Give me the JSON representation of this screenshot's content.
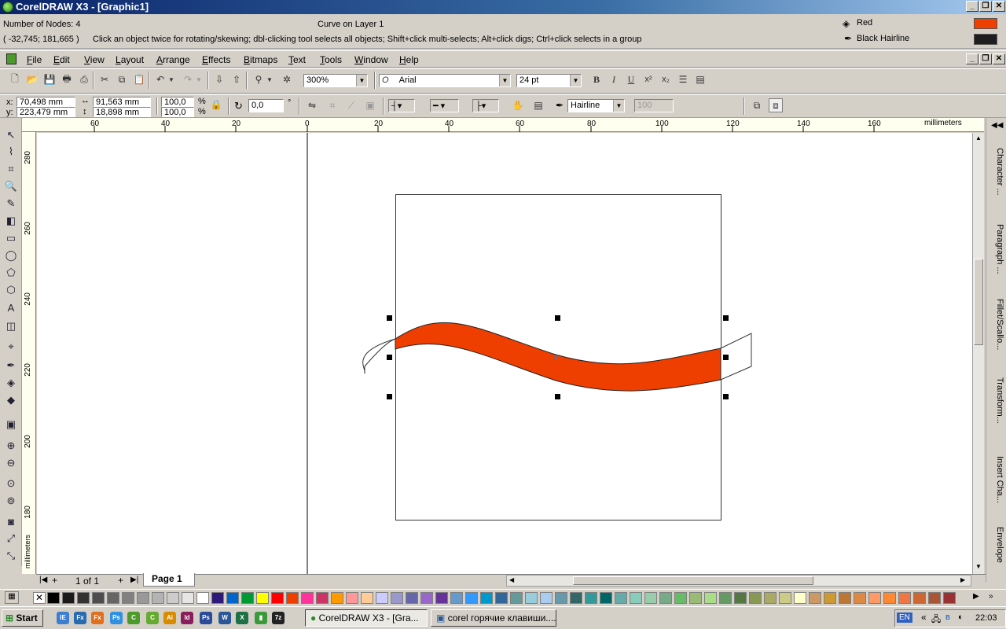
{
  "window": {
    "title": "CorelDRAW X3 - [Graphic1]"
  },
  "info": {
    "nodes": "Number of Nodes: 4",
    "object": "Curve on Layer 1",
    "coords": "( -32,745; 181,665 )",
    "hint": "Click an object twice for rotating/skewing; dbl-clicking tool selects all objects; Shift+click multi-selects; Alt+click digs; Ctrl+click selects in a group",
    "fill_label": "Red",
    "outline_label": "Black  Hairline",
    "fill_color": "#ee3e00",
    "outline_color": "#1e1e1e"
  },
  "menu": [
    "File",
    "Edit",
    "View",
    "Layout",
    "Arrange",
    "Effects",
    "Bitmaps",
    "Text",
    "Tools",
    "Window",
    "Help"
  ],
  "toolbar": {
    "zoom": "300%",
    "font": "Arial",
    "font_size": "24 pt"
  },
  "properties": {
    "x": "70,498 mm",
    "y": "223,479 mm",
    "width": "91,563 mm",
    "height": "18,898 mm",
    "scale_x": "100,0",
    "scale_y": "100,0",
    "pct1": "%",
    "pct2": "%",
    "angle": "0,0",
    "deg": "°",
    "outline_width": "Hairline",
    "opacity": "100"
  },
  "ruler": {
    "h_ticks": [
      "60",
      "40",
      "20",
      "0",
      "20",
      "40",
      "60",
      "80",
      "100",
      "120",
      "140",
      "160"
    ],
    "v_ticks": [
      "280",
      "260",
      "240",
      "220",
      "200",
      "180"
    ],
    "units": "millimeters",
    "v_units": "millimeters"
  },
  "dockers": [
    "Character ...",
    "Paragraph ...",
    "Fillet/Scallo...",
    "Transform...",
    "Insert Cha...",
    "Envelope"
  ],
  "pagebar": {
    "count": "1 of 1",
    "page_tab": "Page 1"
  },
  "palette_colors": [
    "#000000",
    "#1a1a1a",
    "#333333",
    "#4d4d4d",
    "#666666",
    "#808080",
    "#999999",
    "#b3b3b3",
    "#cccccc",
    "#e6e6e6",
    "#ffffff",
    "#2e1a78",
    "#0066cc",
    "#009933",
    "#ffff00",
    "#ff0000",
    "#ee3e00",
    "#ff3399",
    "#cc3366",
    "#ff9900",
    "#ff9999",
    "#ffcc99",
    "#ccccff",
    "#9999cc",
    "#6666aa",
    "#9966cc",
    "#663399",
    "#6699cc",
    "#3399ff",
    "#0099cc",
    "#336699",
    "#669999",
    "#99ccdd",
    "#aaccee",
    "#6699aa",
    "#336666",
    "#339999",
    "#006666",
    "#66aaaa",
    "#88ccbb",
    "#99ccaa",
    "#77aa88",
    "#66bb66",
    "#99bb77",
    "#aadd88",
    "#669966",
    "#557744",
    "#889955",
    "#aaaa66",
    "#cccc88",
    "#ffffcc",
    "#cc9966",
    "#cc9933",
    "#bb7733",
    "#dd8844",
    "#ff9966",
    "#ff8833",
    "#ee7744",
    "#cc6633",
    "#aa5533",
    "#993333"
  ],
  "taskbar": {
    "start": "Start",
    "task1": "CorelDRAW X3 - [Gra...",
    "task2": "corel горячие клавиши....",
    "lang": "EN",
    "clock": "22:03",
    "arrows": "«",
    "ql": [
      "IE",
      "Fx",
      "Ps",
      "Ai",
      "Id",
      "Ps",
      "W",
      "X",
      "7z"
    ]
  }
}
